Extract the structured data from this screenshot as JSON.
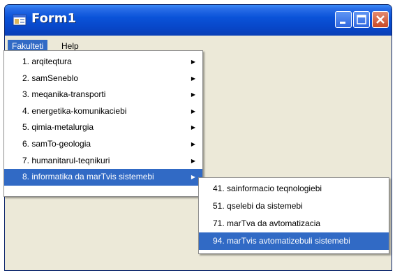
{
  "window": {
    "title": "Form1"
  },
  "menubar": {
    "items": [
      {
        "label": "Fakulteti",
        "active": true
      },
      {
        "label": "Help",
        "active": false
      }
    ]
  },
  "dropdown_main": {
    "items": [
      {
        "label": "1. arqiteqtura",
        "has_submenu": true
      },
      {
        "label": "2. samSeneblo",
        "has_submenu": true
      },
      {
        "label": "3. meqanika-transporti",
        "has_submenu": true
      },
      {
        "label": "4. energetika-komunikaciebi",
        "has_submenu": true
      },
      {
        "label": "5. qimia-metalurgia",
        "has_submenu": true
      },
      {
        "label": "6. samTo-geologia",
        "has_submenu": true
      },
      {
        "label": "7. humanitarul-teqnikuri",
        "has_submenu": true
      },
      {
        "label": "8. informatika da marTvis sistemebi",
        "has_submenu": true,
        "selected": true
      }
    ]
  },
  "dropdown_sub": {
    "items": [
      {
        "label": "41. sainformacio teqnologiebi"
      },
      {
        "label": "51. qselebi da sistemebi"
      },
      {
        "label": "71. marTva da avtomatizacia"
      },
      {
        "label": "94. marTvis avtomatizebuli sistemebi",
        "selected": true
      }
    ]
  },
  "icons": {
    "app": "form-window-icon",
    "submenu_arrow": "arrow-right-icon",
    "minimize": "minimize-icon",
    "maximize": "maximize-icon",
    "close": "close-icon"
  },
  "colors": {
    "title_bar": "#0a53d9",
    "selection": "#316ac5",
    "window_bg": "#ece9d8",
    "close_button": "#c94826"
  }
}
